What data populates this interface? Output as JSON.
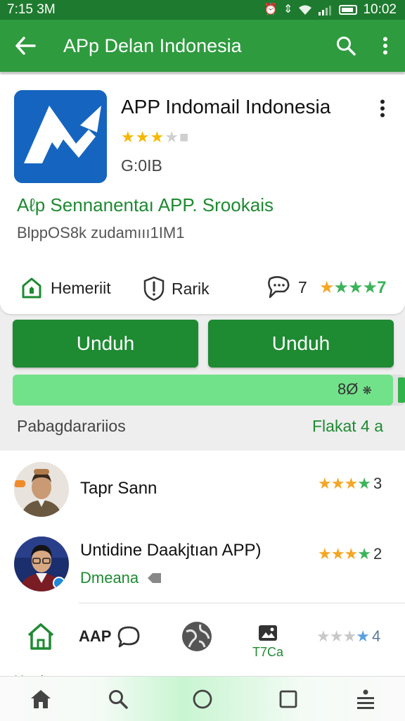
{
  "status_bar": {
    "time": "7:15 3M",
    "clock": "10:02"
  },
  "app_bar": {
    "title": "APp Delan Indonesia"
  },
  "app": {
    "name": "APP Indomail Indonesia",
    "rating_stars": 3,
    "rating_max": 5,
    "size": "G:0IB",
    "developer": "Aℓp Sennanentaı APP. Srookais",
    "downloads": "BlppOS8k zudamııı1IM1"
  },
  "meta": {
    "item1_label": "Hemeriit",
    "item2_label": "Rarik",
    "item3_count": "7",
    "stars_label": "7"
  },
  "buttons": {
    "left_label": "Unduh",
    "right_label": "Unduh"
  },
  "progress": {
    "fraction": 0.97,
    "text": "8Ø"
  },
  "status_row": {
    "left": "Pabagdarariios",
    "right": "Flakat 4 a"
  },
  "reviews": [
    {
      "name": "Tapr Sann",
      "stars_filled": 4,
      "stars_max": 4,
      "count": "3"
    },
    {
      "name": "Untidine Daakjtıan APP)",
      "subtitle": "Dmeana",
      "stars_filled": 4,
      "stars_max": 4,
      "count": "2"
    }
  ],
  "tab_row": {
    "app_label": "AAP",
    "photo_label": "T7Ca",
    "rating_count": "4",
    "bottom_label": "Mrcale"
  },
  "colors": {
    "primary": "#2e9b3e",
    "dark": "#1e7a2e",
    "button": "#1e8a32",
    "progress": "#72e28a"
  }
}
